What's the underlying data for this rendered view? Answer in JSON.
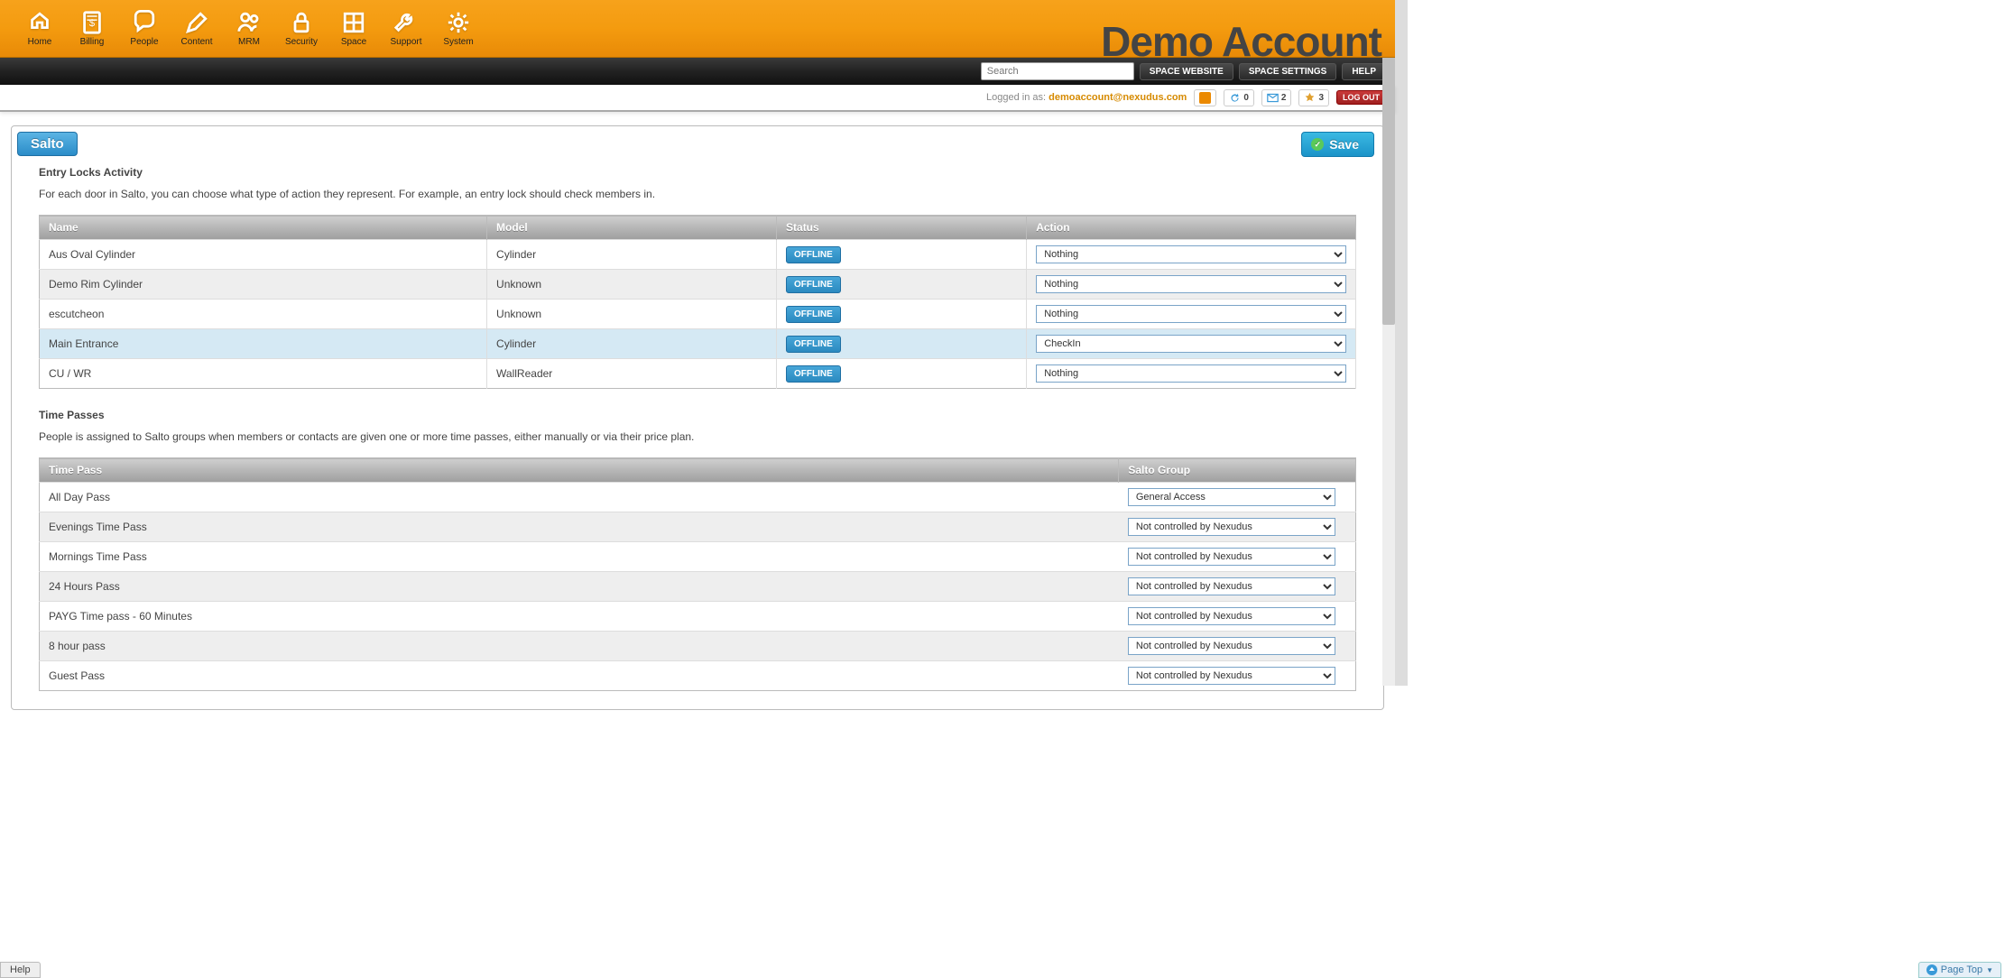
{
  "brand": "Demo Account",
  "nav": [
    {
      "label": "Home",
      "icon": "home"
    },
    {
      "label": "Billing",
      "icon": "billing"
    },
    {
      "label": "People",
      "icon": "chat"
    },
    {
      "label": "Content",
      "icon": "pen"
    },
    {
      "label": "MRM",
      "icon": "people"
    },
    {
      "label": "Security",
      "icon": "lock"
    },
    {
      "label": "Space",
      "icon": "grid"
    },
    {
      "label": "Support",
      "icon": "wrench"
    },
    {
      "label": "System",
      "icon": "gear"
    }
  ],
  "subbar": {
    "search_placeholder": "Search",
    "space_website": "SPACE WEBSITE",
    "space_settings": "SPACE SETTINGS",
    "help": "HELP"
  },
  "userbar": {
    "logged_in_prefix": "Logged in as: ",
    "email": "demoaccount@nexudus.com",
    "count_a": "0",
    "count_b": "2",
    "count_c": "3",
    "logout": "LOG OUT"
  },
  "tab": "Salto",
  "save": "Save",
  "locks_section": {
    "title": "Entry Locks Activity",
    "desc": "For each door in Salto, you can choose what type of action they represent. For example, an entry lock should check members in.",
    "headers": {
      "name": "Name",
      "model": "Model",
      "status": "Status",
      "action": "Action"
    },
    "rows": [
      {
        "name": "Aus Oval Cylinder",
        "model": "Cylinder",
        "status": "OFFLINE",
        "action": "Nothing",
        "highlight": false
      },
      {
        "name": "Demo Rim Cylinder",
        "model": "Unknown",
        "status": "OFFLINE",
        "action": "Nothing",
        "highlight": false
      },
      {
        "name": "escutcheon",
        "model": "Unknown",
        "status": "OFFLINE",
        "action": "Nothing",
        "highlight": false
      },
      {
        "name": "Main Entrance",
        "model": "Cylinder",
        "status": "OFFLINE",
        "action": "CheckIn",
        "highlight": true
      },
      {
        "name": "CU / WR",
        "model": "WallReader",
        "status": "OFFLINE",
        "action": "Nothing",
        "highlight": false
      }
    ],
    "action_options": [
      "Nothing",
      "CheckIn"
    ]
  },
  "passes_section": {
    "title": "Time Passes",
    "desc": "People is assigned to Salto groups when members or contacts are given one or more time passes, either manually or via their price plan.",
    "headers": {
      "pass": "Time Pass",
      "group": "Salto Group"
    },
    "rows": [
      {
        "pass": "All Day Pass",
        "group": "General Access"
      },
      {
        "pass": "Evenings Time Pass",
        "group": "Not controlled by Nexudus"
      },
      {
        "pass": "Mornings Time Pass",
        "group": "Not controlled by Nexudus"
      },
      {
        "pass": "24 Hours Pass",
        "group": "Not controlled by Nexudus"
      },
      {
        "pass": "PAYG Time pass - 60 Minutes",
        "group": "Not controlled by Nexudus"
      },
      {
        "pass": "8 hour pass",
        "group": "Not controlled by Nexudus"
      },
      {
        "pass": "Guest Pass",
        "group": "Not controlled by Nexudus"
      }
    ],
    "group_options": [
      "General Access",
      "Not controlled by Nexudus"
    ]
  },
  "footer": {
    "help": "Help",
    "pagetop": "Page Top"
  }
}
